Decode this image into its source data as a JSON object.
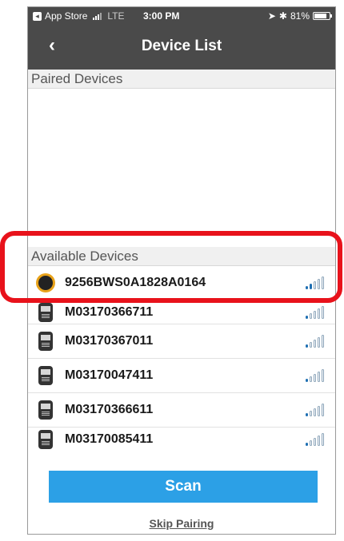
{
  "status_bar": {
    "back_app": "App Store",
    "network": "LTE",
    "time": "3:00 PM",
    "battery": "81%",
    "battery_level": 0.81
  },
  "nav": {
    "back_icon": "chevron-left-icon",
    "title": "Device List"
  },
  "sections": {
    "paired": "Paired Devices",
    "available": "Available Devices"
  },
  "devices": [
    {
      "name": "9256BWS0A1828A0164",
      "icon": "round-gas-detector-icon",
      "signal_bars": 2
    },
    {
      "name": "M03170366711",
      "icon": "gas-monitor-icon",
      "signal_bars": 1
    },
    {
      "name": "M03170367011",
      "icon": "gas-monitor-icon",
      "signal_bars": 1
    },
    {
      "name": "M03170047411",
      "icon": "gas-monitor-icon",
      "signal_bars": 1
    },
    {
      "name": "M03170366611",
      "icon": "gas-monitor-icon",
      "signal_bars": 1
    },
    {
      "name": "M03170085411",
      "icon": "gas-monitor-icon",
      "signal_bars": 1
    }
  ],
  "actions": {
    "scan": "Scan",
    "skip": "Skip Pairing"
  },
  "colors": {
    "header_bg": "#4a4a4a",
    "accent": "#2ca0e6",
    "highlight": "#e8121b"
  }
}
